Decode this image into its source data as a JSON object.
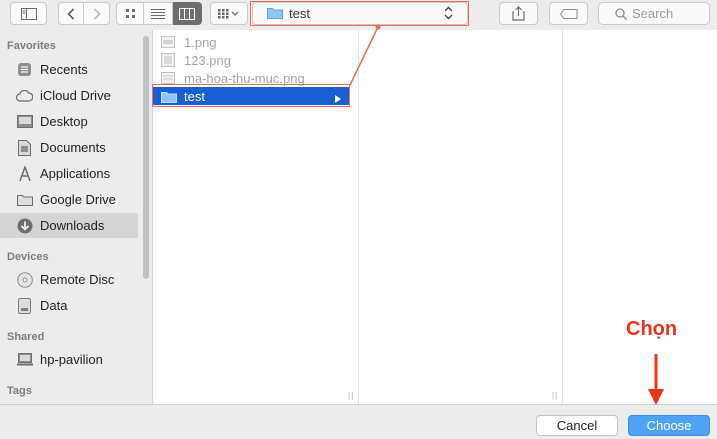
{
  "toolbar": {
    "location": "test",
    "search_placeholder": "Search"
  },
  "sidebar": {
    "sections": {
      "favorites": "Favorites",
      "devices": "Devices",
      "shared": "Shared",
      "tags": "Tags"
    },
    "favorites": [
      {
        "label": "Recents",
        "icon": "clock-icon"
      },
      {
        "label": "iCloud Drive",
        "icon": "cloud-icon"
      },
      {
        "label": "Desktop",
        "icon": "desktop-icon"
      },
      {
        "label": "Documents",
        "icon": "document-icon"
      },
      {
        "label": "Applications",
        "icon": "applications-icon"
      },
      {
        "label": "Google Drive",
        "icon": "folder-icon"
      },
      {
        "label": "Downloads",
        "icon": "download-icon"
      }
    ],
    "devices": [
      {
        "label": "Remote Disc",
        "icon": "disc-icon"
      },
      {
        "label": "Data",
        "icon": "drive-icon"
      }
    ],
    "shared": [
      {
        "label": "hp-pavilion",
        "icon": "computer-icon"
      }
    ],
    "selected": "Downloads"
  },
  "browser": {
    "files": [
      {
        "name": "1.png",
        "kind": "image"
      },
      {
        "name": "123.png",
        "kind": "image"
      },
      {
        "name": "ma-hoa-thu-muc.png",
        "kind": "image"
      },
      {
        "name": "test",
        "kind": "folder"
      }
    ],
    "selected": "test"
  },
  "buttons": {
    "cancel": "Cancel",
    "choose": "Choose"
  },
  "annotation": {
    "text": "Chọn",
    "color": "#e8351d"
  },
  "colors": {
    "selection": "#1a5fd1",
    "choose_button": "#4ea3f4",
    "annotation_box": "#ea6b5b"
  }
}
